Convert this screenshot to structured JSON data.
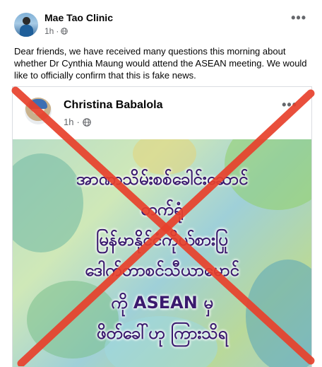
{
  "post": {
    "page_name": "Mae Tao Clinic",
    "time": "1h",
    "privacy_icon": "globe-icon",
    "more_icon": "more-horizontal-icon",
    "text": "Dear friends, we have received many questions this morning about whether Dr Cynthia Maung would attend the ASEAN meeting. We would like to officially confirm that this is fake news."
  },
  "shared_post": {
    "author": "Christina Babalola",
    "time": "1h",
    "privacy_icon": "globe-icon",
    "more_icon": "more-horizontal-icon",
    "image_text_lines": [
      "အာဏာသိမ်းစစ်ခေါင်းဆောင်",
      "တက်ရုံ",
      "မြန်မာနိုင်ငံကိုယ်စားပြု",
      "ဒေါက်တာစင်သီယာမောင်",
      "ကို ASEAN မှ",
      "ဖိတ်ခေါ်ဟု ကြားသိရ"
    ]
  },
  "colors": {
    "cross": "#e8412c",
    "image_text": "#3a1a6e",
    "secondary_text": "#65676b"
  }
}
